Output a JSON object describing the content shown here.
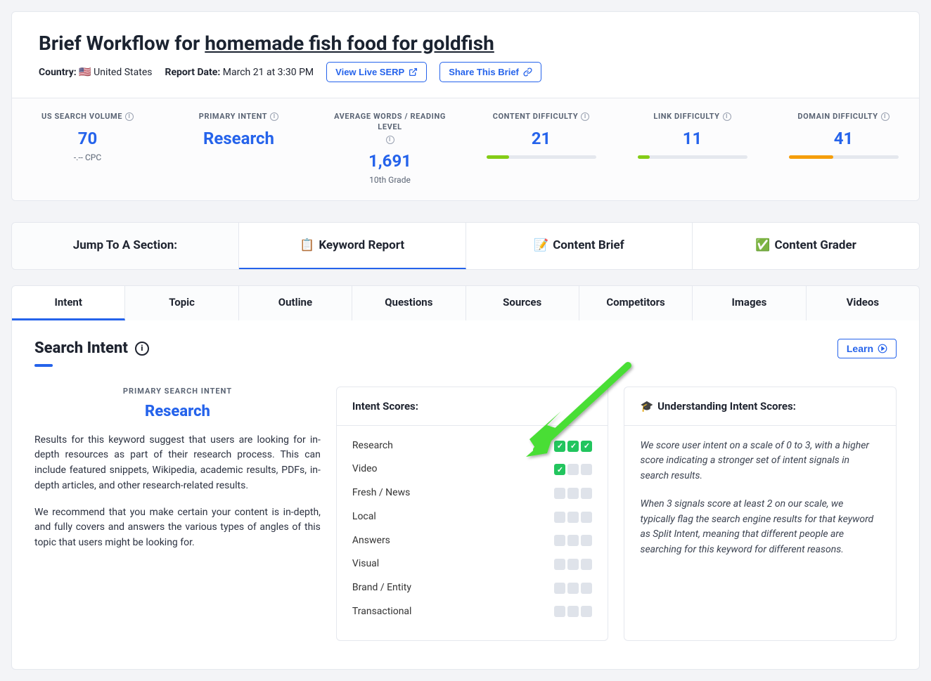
{
  "header": {
    "title_prefix": "Brief Workflow for ",
    "keyword": "homemade fish food for goldfish",
    "country_label": "Country:",
    "country_flag": "🇺🇸",
    "country_name": "United States",
    "report_label": "Report Date:",
    "report_date": "March 21 at 3:30 PM",
    "view_serp": "View Live SERP",
    "share_brief": "Share This Brief"
  },
  "stats": [
    {
      "label": "US SEARCH VOLUME",
      "value": "70",
      "sub": "-.-- CPC",
      "bar": null
    },
    {
      "label": "PRIMARY INTENT",
      "value": "Research",
      "sub": "",
      "bar": null
    },
    {
      "label": "AVERAGE WORDS / READING LEVEL",
      "value": "1,691",
      "sub": "10th Grade",
      "bar": null
    },
    {
      "label": "CONTENT DIFFICULTY",
      "value": "21",
      "sub": "",
      "bar": {
        "pct": 21,
        "color": "#84cc16"
      }
    },
    {
      "label": "LINK DIFFICULTY",
      "value": "11",
      "sub": "",
      "bar": {
        "pct": 11,
        "color": "#84cc16"
      }
    },
    {
      "label": "DOMAIN DIFFICULTY",
      "value": "41",
      "sub": "",
      "bar": {
        "pct": 41,
        "color": "#f59e0b"
      }
    }
  ],
  "jump": {
    "label": "Jump To A Section:",
    "tabs": [
      {
        "emoji": "📋",
        "label": "Keyword Report",
        "active": true
      },
      {
        "emoji": "📝",
        "label": "Content Brief",
        "active": false
      },
      {
        "emoji": "✅",
        "label": "Content Grader",
        "active": false
      }
    ]
  },
  "subtabs": [
    "Intent",
    "Topic",
    "Outline",
    "Questions",
    "Sources",
    "Competitors",
    "Images",
    "Videos"
  ],
  "subtab_active": 0,
  "si": {
    "heading": "Search Intent",
    "learn": "Learn",
    "psi_label": "PRIMARY SEARCH INTENT",
    "psi_value": "Research",
    "p1": "Results for this keyword suggest that users are looking for in-depth resources as part of their research process. This can include featured snippets, Wikipedia, academic results, PDFs, in-depth articles, and other research-related results.",
    "p2": "We recommend that you make certain your content is in-depth, and fully covers and answers the various types of angles of this topic that users might be looking for.",
    "scores_title": "Intent Scores:",
    "scores": [
      {
        "name": "Research",
        "score": 3
      },
      {
        "name": "Video",
        "score": 1
      },
      {
        "name": "Fresh / News",
        "score": 0
      },
      {
        "name": "Local",
        "score": 0
      },
      {
        "name": "Answers",
        "score": 0
      },
      {
        "name": "Visual",
        "score": 0
      },
      {
        "name": "Brand / Entity",
        "score": 0
      },
      {
        "name": "Transactional",
        "score": 0
      }
    ],
    "understand_title": "Understanding Intent Scores:",
    "understand_icon": "🎓",
    "u1": "We score user intent on a scale of 0 to 3, with a higher score indicating a stronger set of intent signals in search results.",
    "u2": "When 3 signals score at least 2 on our scale, we typically flag the search engine results for that keyword as Split Intent, meaning that different people are searching for this keyword for different reasons."
  }
}
